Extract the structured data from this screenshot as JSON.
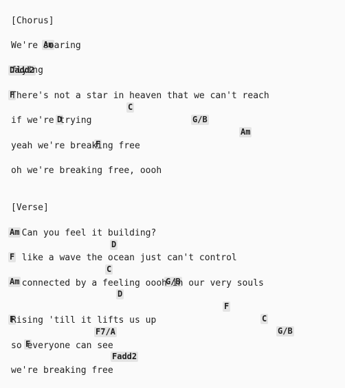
{
  "lines": [
    {
      "type": "section",
      "text": "[Chorus]"
    },
    {
      "type": "chords",
      "chords": [
        "Am"
      ]
    },
    {
      "type": "lyric",
      "text": "We're soaring"
    },
    {
      "type": "chords",
      "chords": [
        "Dadd2"
      ]
    },
    {
      "type": "lyric",
      "text": "flying"
    },
    {
      "type": "chords",
      "chords": [
        "F",
        "C",
        "G/B",
        "Am"
      ]
    },
    {
      "type": "lyric",
      "text": "There's not a star in heaven that we can't reach"
    },
    {
      "type": "chords",
      "chords": [
        "D"
      ]
    },
    {
      "type": "lyric",
      "text": "if we're trying"
    },
    {
      "type": "chords",
      "chords": [
        "F"
      ]
    },
    {
      "type": "lyric",
      "text": "yeah we're breaking free"
    },
    {
      "type": "lyric",
      "text": "oh we're breaking free, oooh"
    },
    {
      "type": "section",
      "text": "[Verse]"
    },
    {
      "type": "chords",
      "chords": [
        "Am",
        "D"
      ]
    },
    {
      "type": "lyric",
      "text": "  Can you feel it building?"
    },
    {
      "type": "chords",
      "chords": [
        "F",
        "C",
        "G/B"
      ]
    },
    {
      "type": "lyric",
      "text": "  like a wave the ocean just can't control"
    },
    {
      "type": "chords",
      "chords": [
        "Am",
        "D",
        "F",
        "C",
        "G/B"
      ]
    },
    {
      "type": "lyric",
      "text": "  connected by a feeling oooh in our very souls"
    },
    {
      "type": "chords",
      "chords": [
        "F",
        "F7/A"
      ]
    },
    {
      "type": "lyric",
      "text": "Rising 'till it lifts us up"
    },
    {
      "type": "chords",
      "chords": [
        "F",
        "Fadd2"
      ]
    },
    {
      "type": "lyric",
      "text": "so everyone can see"
    },
    {
      "type": "lyric",
      "text": "we're breaking free"
    }
  ]
}
